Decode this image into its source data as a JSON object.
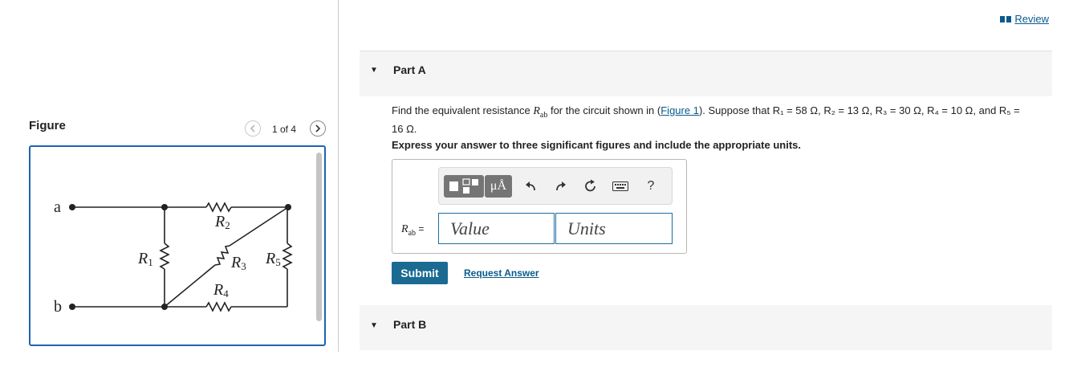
{
  "figure": {
    "title": "Figure",
    "page_count": "1 of 4",
    "circuit": {
      "node_a": "a",
      "node_b": "b",
      "r1": "R",
      "r1_sub": "1",
      "r2": "R",
      "r2_sub": "2",
      "r3": "R",
      "r3_sub": "3",
      "r4": "R",
      "r4_sub": "4",
      "r5": "R",
      "r5_sub": "5"
    }
  },
  "header": {
    "review_label": "Review"
  },
  "part_a": {
    "label": "Part A",
    "question_prefix": "Find the equivalent resistance ",
    "question_sym": "R",
    "question_sym_sub": "ab",
    "question_mid": " for the circuit shown in (",
    "figure_link": "Figure 1",
    "question_suffix": "). Suppose that R₁ = 58 Ω, R₂ = 13 Ω, R₃ = 30 Ω, R₄ = 10 Ω, and R₅ = 16 Ω.",
    "instruction": "Express your answer to three significant figures and include the appropriate units.",
    "answer_label": "R",
    "answer_label_sub": "ab",
    "answer_eq": " =",
    "value_placeholder": "Value",
    "units_placeholder": "Units",
    "toolbar": {
      "units_button": "μÅ",
      "help": "?"
    },
    "submit_label": "Submit",
    "request_answer_label": "Request Answer"
  },
  "part_b": {
    "label": "Part B"
  },
  "colors": {
    "accent_blue": "#1e63b5",
    "link": "#0a5a8c",
    "submit_bg": "#1b6a92"
  }
}
